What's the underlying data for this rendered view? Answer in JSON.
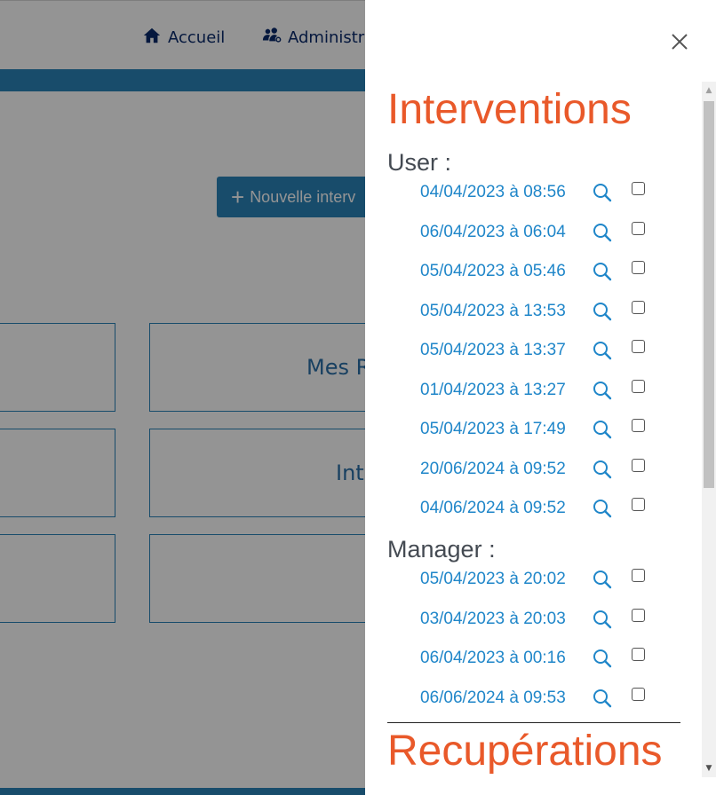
{
  "nav": {
    "home_label": "Accueil",
    "admin_label": "Administra"
  },
  "main": {
    "new_button_label": "Nouvelle interv",
    "tiles": [
      "",
      "Mes R",
      "",
      "Inte",
      "",
      ""
    ]
  },
  "drawer": {
    "interventions_title": "Interventions",
    "user_label": "User :",
    "manager_label": "Manager :",
    "recuperations_title": "Recupérations",
    "user_items": [
      "04/04/2023 à 08:56",
      "06/04/2023 à 06:04",
      "05/04/2023 à 05:46",
      "05/04/2023 à 13:53",
      "05/04/2023 à 13:37",
      "01/04/2023 à 13:27",
      "05/04/2023 à 17:49",
      "20/06/2024 à 09:52",
      "04/06/2024 à 09:52"
    ],
    "manager_items": [
      "05/04/2023 à 20:02",
      "03/04/2023 à 20:03",
      "06/04/2023 à 00:16",
      "06/06/2024 à 09:53"
    ]
  },
  "colors": {
    "accent_blue": "#2a83b9",
    "title_orange": "#e9592a",
    "link_blue": "#1f86c9"
  }
}
